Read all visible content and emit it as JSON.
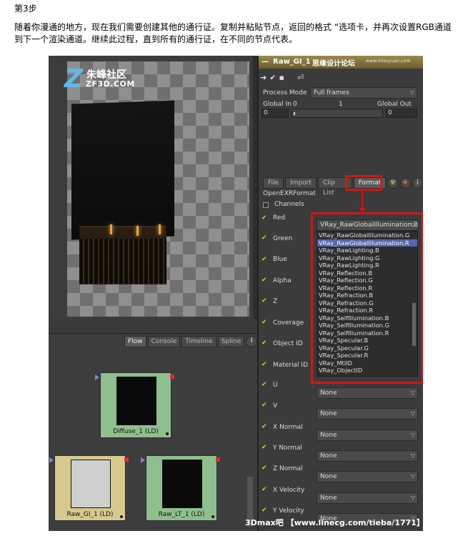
{
  "step": "第3步",
  "paragraph": "随着你漫通的地方，现在我们需要创建其他的通行证。复制并粘贴节点，返回的格式 “选项卡，并再次设置RGB通道到下一个渲染通道。继续此过程，直到所有的通行证，在不同的节点代表。",
  "logo": {
    "cn": "朱峰社区",
    "en": "ZF3D.COM"
  },
  "panel": {
    "title": "Raw_GI_1",
    "watermark_cn": "思缘设计论坛",
    "watermark_url": "www.missyuan.com",
    "process_mode_label": "Process Mode",
    "process_mode_value": "Full frames",
    "global_in_label": "Global In",
    "global_in_value": "0",
    "range_start": "0",
    "range_mid": "1",
    "global_out_label": "Global Out",
    "global_out_value": "0",
    "tabs": [
      "File",
      "Import",
      "Clip List",
      "Format"
    ],
    "format_name": "OpenEXRFormat",
    "channels_label": "Channels",
    "channels": [
      "Red",
      "Green",
      "Blue",
      "Alpha",
      "Z",
      "Coverage",
      "Object ID",
      "Material ID"
    ],
    "red_value": "VRay_RawGlobalIllumination.B",
    "channel_list": [
      "VRay_RawGlobalIllumination.G",
      "VRay_RawGlobalIllumination.R",
      "VRay_RawLighting.B",
      "VRay_RawLighting.G",
      "VRay_RawLighting.R",
      "VRay_Reflection.B",
      "VRay_Reflection.G",
      "VRay_Reflection.R",
      "VRay_Refraction.B",
      "VRay_Refraction.G",
      "VRay_Refraction.R",
      "VRay_SelfIllumination.B",
      "VRay_SelfIllumination.G",
      "VRay_SelfIllumination.R",
      "VRay_Specular.B",
      "VRay_Specular.G",
      "VRay_Specular.R",
      "VRay_MtlID",
      "VRay_ObjectID"
    ],
    "lower_channels": [
      {
        "label": "U",
        "value": "None"
      },
      {
        "label": "V",
        "value": "None"
      },
      {
        "label": "X Normal",
        "value": "None"
      },
      {
        "label": "Y Normal",
        "value": "None"
      },
      {
        "label": "Z Normal",
        "value": "None"
      },
      {
        "label": "X Velocity",
        "value": "None"
      },
      {
        "label": "Y Velocity",
        "value": "None"
      }
    ]
  },
  "flow_tabs": [
    "Flow",
    "Console",
    "Timeline",
    "Spline"
  ],
  "nodes": {
    "diffuse": "Diffuse_1 (LD)",
    "raw_gi": "Raw_GI_1 (LD)",
    "raw_lt": "Raw_LT_1 (LD)"
  },
  "bottom_watermark": "3Dmax吧 【www.linecg.com/tieba/1771】",
  "colors": {
    "highlight": "#d01818",
    "selected": "#5566aa",
    "node_green": "#8fbf8f",
    "node_yellow": "#d6c98e"
  }
}
